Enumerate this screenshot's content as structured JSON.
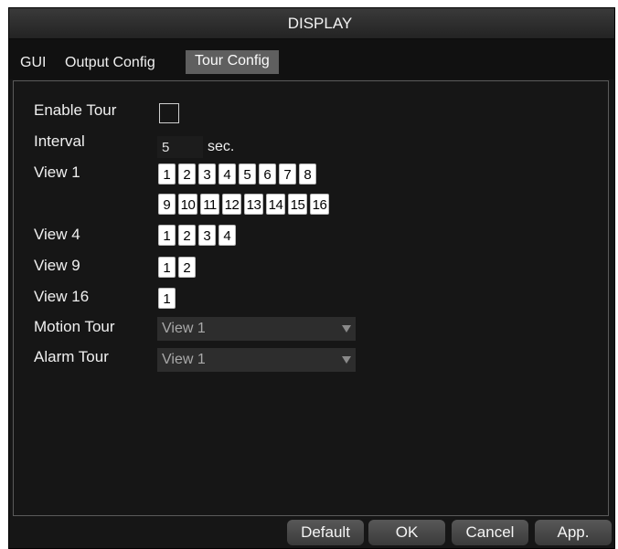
{
  "window": {
    "title": "DISPLAY"
  },
  "tabs": [
    {
      "label": "GUI"
    },
    {
      "label": "Output Config"
    },
    {
      "label": "Tour Config",
      "active": true
    }
  ],
  "tour": {
    "enable_label": "Enable Tour",
    "enable_checked": false,
    "interval_label": "Interval",
    "interval_value": "5",
    "interval_unit": "sec.",
    "view1_label": "View 1",
    "view1_row1": [
      "1",
      "2",
      "3",
      "4",
      "5",
      "6",
      "7",
      "8"
    ],
    "view1_row2": [
      "9",
      "10",
      "11",
      "12",
      "13",
      "14",
      "15",
      "16"
    ],
    "view4_label": "View 4",
    "view4": [
      "1",
      "2",
      "3",
      "4"
    ],
    "view9_label": "View 9",
    "view9": [
      "1",
      "2"
    ],
    "view16_label": "View 16",
    "view16": [
      "1"
    ],
    "motion_label": "Motion Tour",
    "motion_value": "View 1",
    "alarm_label": "Alarm Tour",
    "alarm_value": "View 1"
  },
  "buttons": {
    "default": "Default",
    "ok": "OK",
    "cancel": "Cancel",
    "apply": "App."
  },
  "colors": {
    "background": "#161616",
    "tab_active": "#5f5f5f",
    "channel_button": "#ffffff"
  },
  "icons": {
    "dropdown": "chevron-down-icon"
  }
}
